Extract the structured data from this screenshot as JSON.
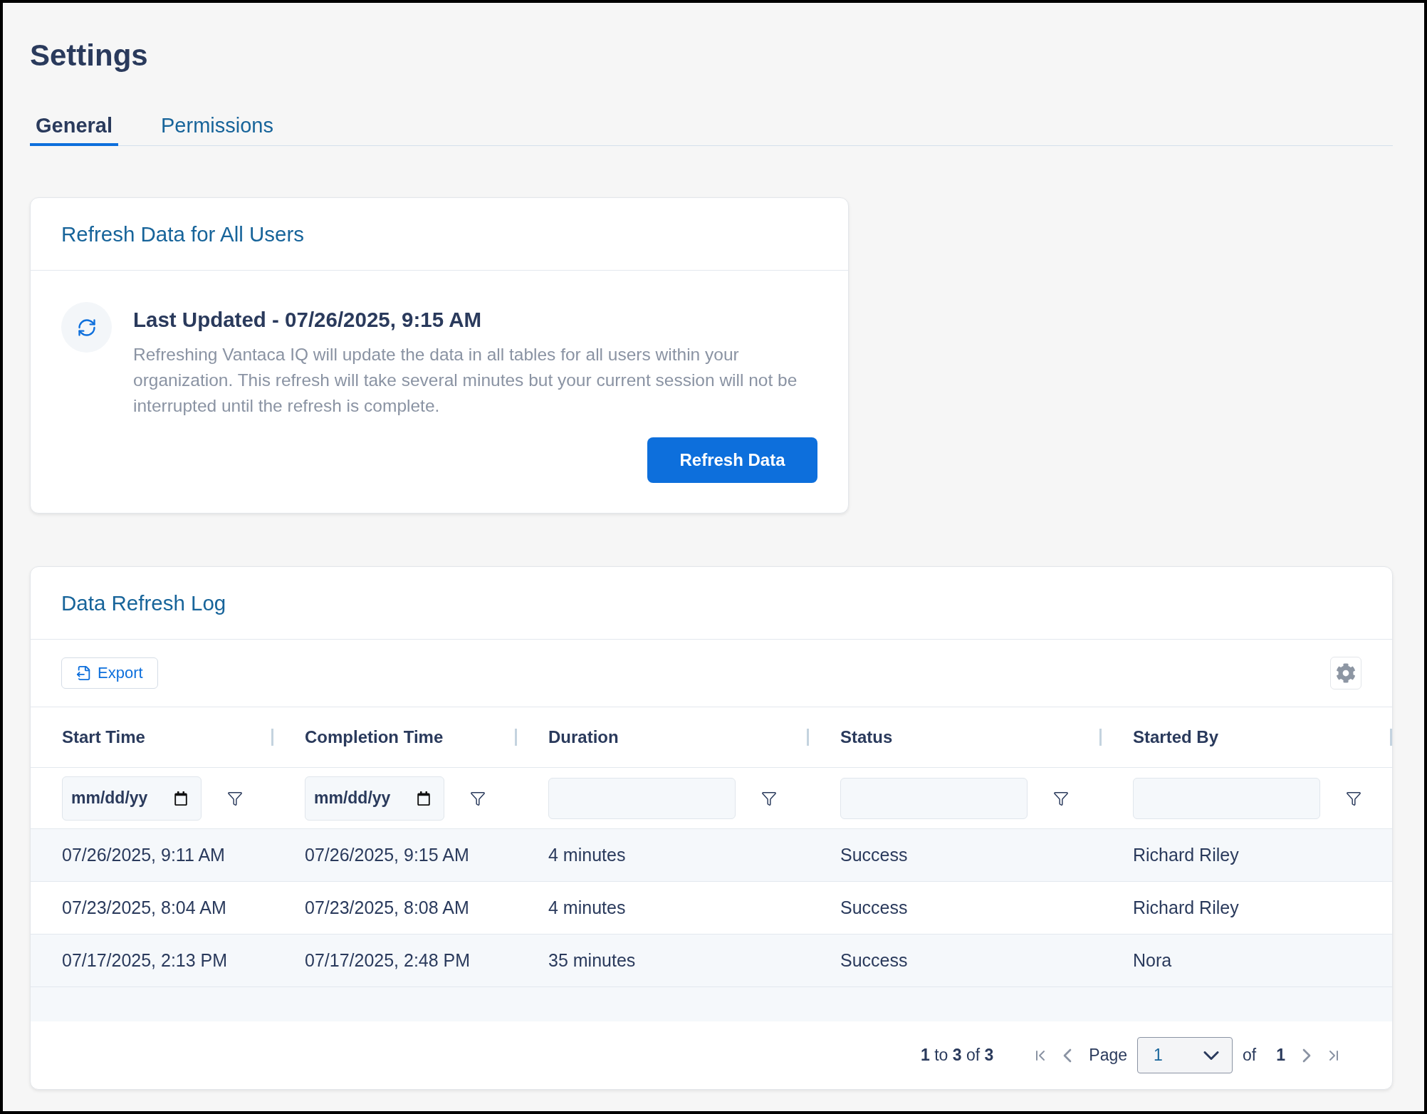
{
  "page": {
    "title": "Settings"
  },
  "tabs": [
    {
      "label": "General",
      "selected": true
    },
    {
      "label": "Permissions",
      "selected": false
    }
  ],
  "refresh_card": {
    "title": "Refresh Data for All Users",
    "heading": "Last Updated - 07/26/2025, 9:15 AM",
    "description": "Refreshing Vantaca IQ will update the data in all tables for all users within your organization. This refresh will take several minutes but your current session will not be interrupted until the refresh is complete.",
    "button": "Refresh Data"
  },
  "log_card": {
    "title": "Data Refresh Log",
    "export_button": "Export",
    "table": {
      "columns": [
        "Start Time",
        "Completion Time",
        "Duration",
        "Status",
        "Started By"
      ],
      "filters": [
        {
          "kind": "date",
          "placeholder": "mm/dd/yy"
        },
        {
          "kind": "date",
          "placeholder": "mm/dd/yy"
        },
        {
          "kind": "text"
        },
        {
          "kind": "text"
        },
        {
          "kind": "text"
        }
      ],
      "rows": [
        [
          "07/26/2025, 9:11 AM",
          "07/26/2025, 9:15 AM",
          "4 minutes",
          "Success",
          "Richard Riley"
        ],
        [
          "07/23/2025, 8:04 AM",
          "07/23/2025, 8:08 AM",
          "4 minutes",
          "Success",
          "Richard Riley"
        ],
        [
          "07/17/2025, 2:13 PM",
          "07/17/2025, 2:48 PM",
          "35 minutes",
          "Success",
          "Nora"
        ]
      ]
    },
    "pagination": {
      "summary": "**1** to **3** of **3**",
      "page_label": "Page",
      "page_value": "1",
      "of_label": "of",
      "total_pages": "1"
    }
  }
}
